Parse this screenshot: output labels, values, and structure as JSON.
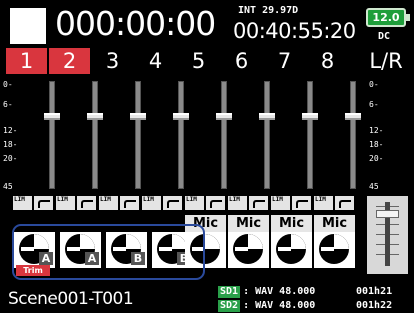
{
  "header": {
    "timecode": "000:00:00",
    "int_rate": "INT 29.97D",
    "rec_remaining": "00:40:55:20",
    "battery": "12.0",
    "power_source": "DC"
  },
  "tracks": [
    {
      "label": "1",
      "armed": true
    },
    {
      "label": "2",
      "armed": true
    },
    {
      "label": "3",
      "armed": false
    },
    {
      "label": "4",
      "armed": false
    },
    {
      "label": "5",
      "armed": false
    },
    {
      "label": "6",
      "armed": false
    },
    {
      "label": "7",
      "armed": false
    },
    {
      "label": "8",
      "armed": false
    },
    {
      "label": "L/R",
      "armed": false
    }
  ],
  "meter_scale": [
    "0-",
    "6-",
    "12-",
    "18-",
    "20-",
    "45"
  ],
  "input_settings": {
    "lim_label": "LIM",
    "mic_label": "Mic",
    "trim_tag": "Trim"
  },
  "knobs": [
    {
      "side": "A"
    },
    {
      "side": "A"
    },
    {
      "side": "B"
    },
    {
      "side": "B"
    },
    {
      "side": ""
    },
    {
      "side": ""
    },
    {
      "side": ""
    },
    {
      "side": ""
    }
  ],
  "footer": {
    "scene": "Scene001-T001",
    "sd1": {
      "tag": "SD1",
      "format": ": WAV 48.000",
      "time": "001h21"
    },
    "sd2": {
      "tag": "SD2",
      "format": ": WAV 48.000",
      "time": "001h22"
    }
  },
  "colors": {
    "armed": "#d9363e",
    "battery": "#1e9e3a",
    "focus": "#2a4a9c"
  }
}
